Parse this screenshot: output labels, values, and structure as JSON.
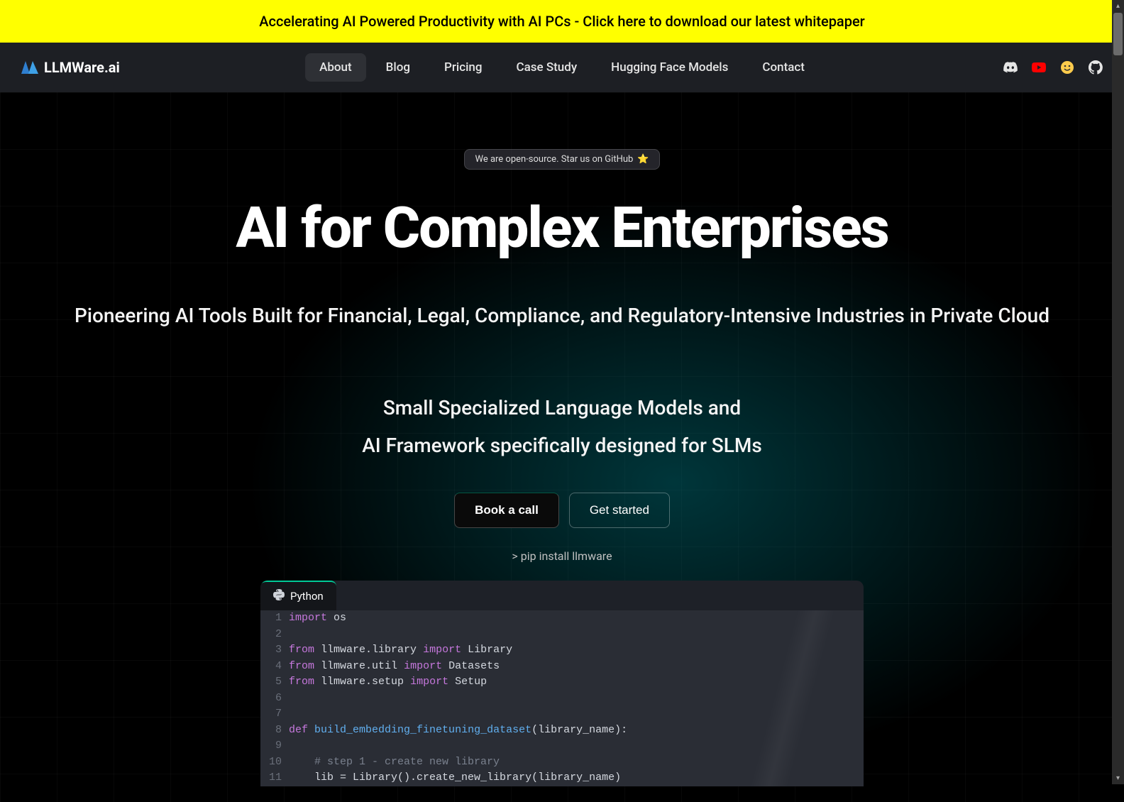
{
  "banner": {
    "text": "Accelerating AI Powered Productivity with AI PCs - Click here to download our latest whitepaper"
  },
  "logo": {
    "text": "LLMWare.ai"
  },
  "nav": {
    "items": [
      {
        "label": "About",
        "active": true
      },
      {
        "label": "Blog",
        "active": false
      },
      {
        "label": "Pricing",
        "active": false
      },
      {
        "label": "Case Study",
        "active": false
      },
      {
        "label": "Hugging Face Models",
        "active": false
      },
      {
        "label": "Contact",
        "active": false
      }
    ]
  },
  "social": {
    "discord": "discord",
    "youtube": "youtube",
    "huggingface": "huggingface",
    "github": "github"
  },
  "hero": {
    "badge": "We are open-source. Star us on GitHub",
    "title": "AI for Complex Enterprises",
    "subtitle": "Pioneering AI Tools Built for Financial, Legal, Compliance, and Regulatory-Intensive Industries in Private Cloud",
    "desc1": "Small Specialized Language Models and",
    "desc2": "AI Framework specifically designed for SLMs",
    "cta_primary": "Book a call",
    "cta_secondary": "Get started",
    "pip": "> pip install llmware"
  },
  "code": {
    "tab": "Python",
    "lines": [
      {
        "n": "1",
        "html": "<span class='kw'>import</span> <span class='pl'>os</span>"
      },
      {
        "n": "2",
        "html": ""
      },
      {
        "n": "3",
        "html": "<span class='kw'>from</span> <span class='pl'>llmware.library</span> <span class='kw'>import</span> <span class='pl'>Library</span>"
      },
      {
        "n": "4",
        "html": "<span class='kw'>from</span> <span class='pl'>llmware.util</span> <span class='kw'>import</span> <span class='pl'>Datasets</span>"
      },
      {
        "n": "5",
        "html": "<span class='kw'>from</span> <span class='pl'>llmware.setup</span> <span class='kw'>import</span> <span class='pl'>Setup</span>"
      },
      {
        "n": "6",
        "html": ""
      },
      {
        "n": "7",
        "html": ""
      },
      {
        "n": "8",
        "html": "<span class='kw'>def</span> <span class='fn'>build_embedding_finetuning_dataset</span><span class='pl'>(library_name):</span>"
      },
      {
        "n": "9",
        "html": ""
      },
      {
        "n": "10",
        "html": "    <span class='cm'># step 1 - create new library</span>"
      },
      {
        "n": "11",
        "html": "    <span class='pl'>lib = Library().create_new_library(library_name)</span>"
      }
    ]
  }
}
